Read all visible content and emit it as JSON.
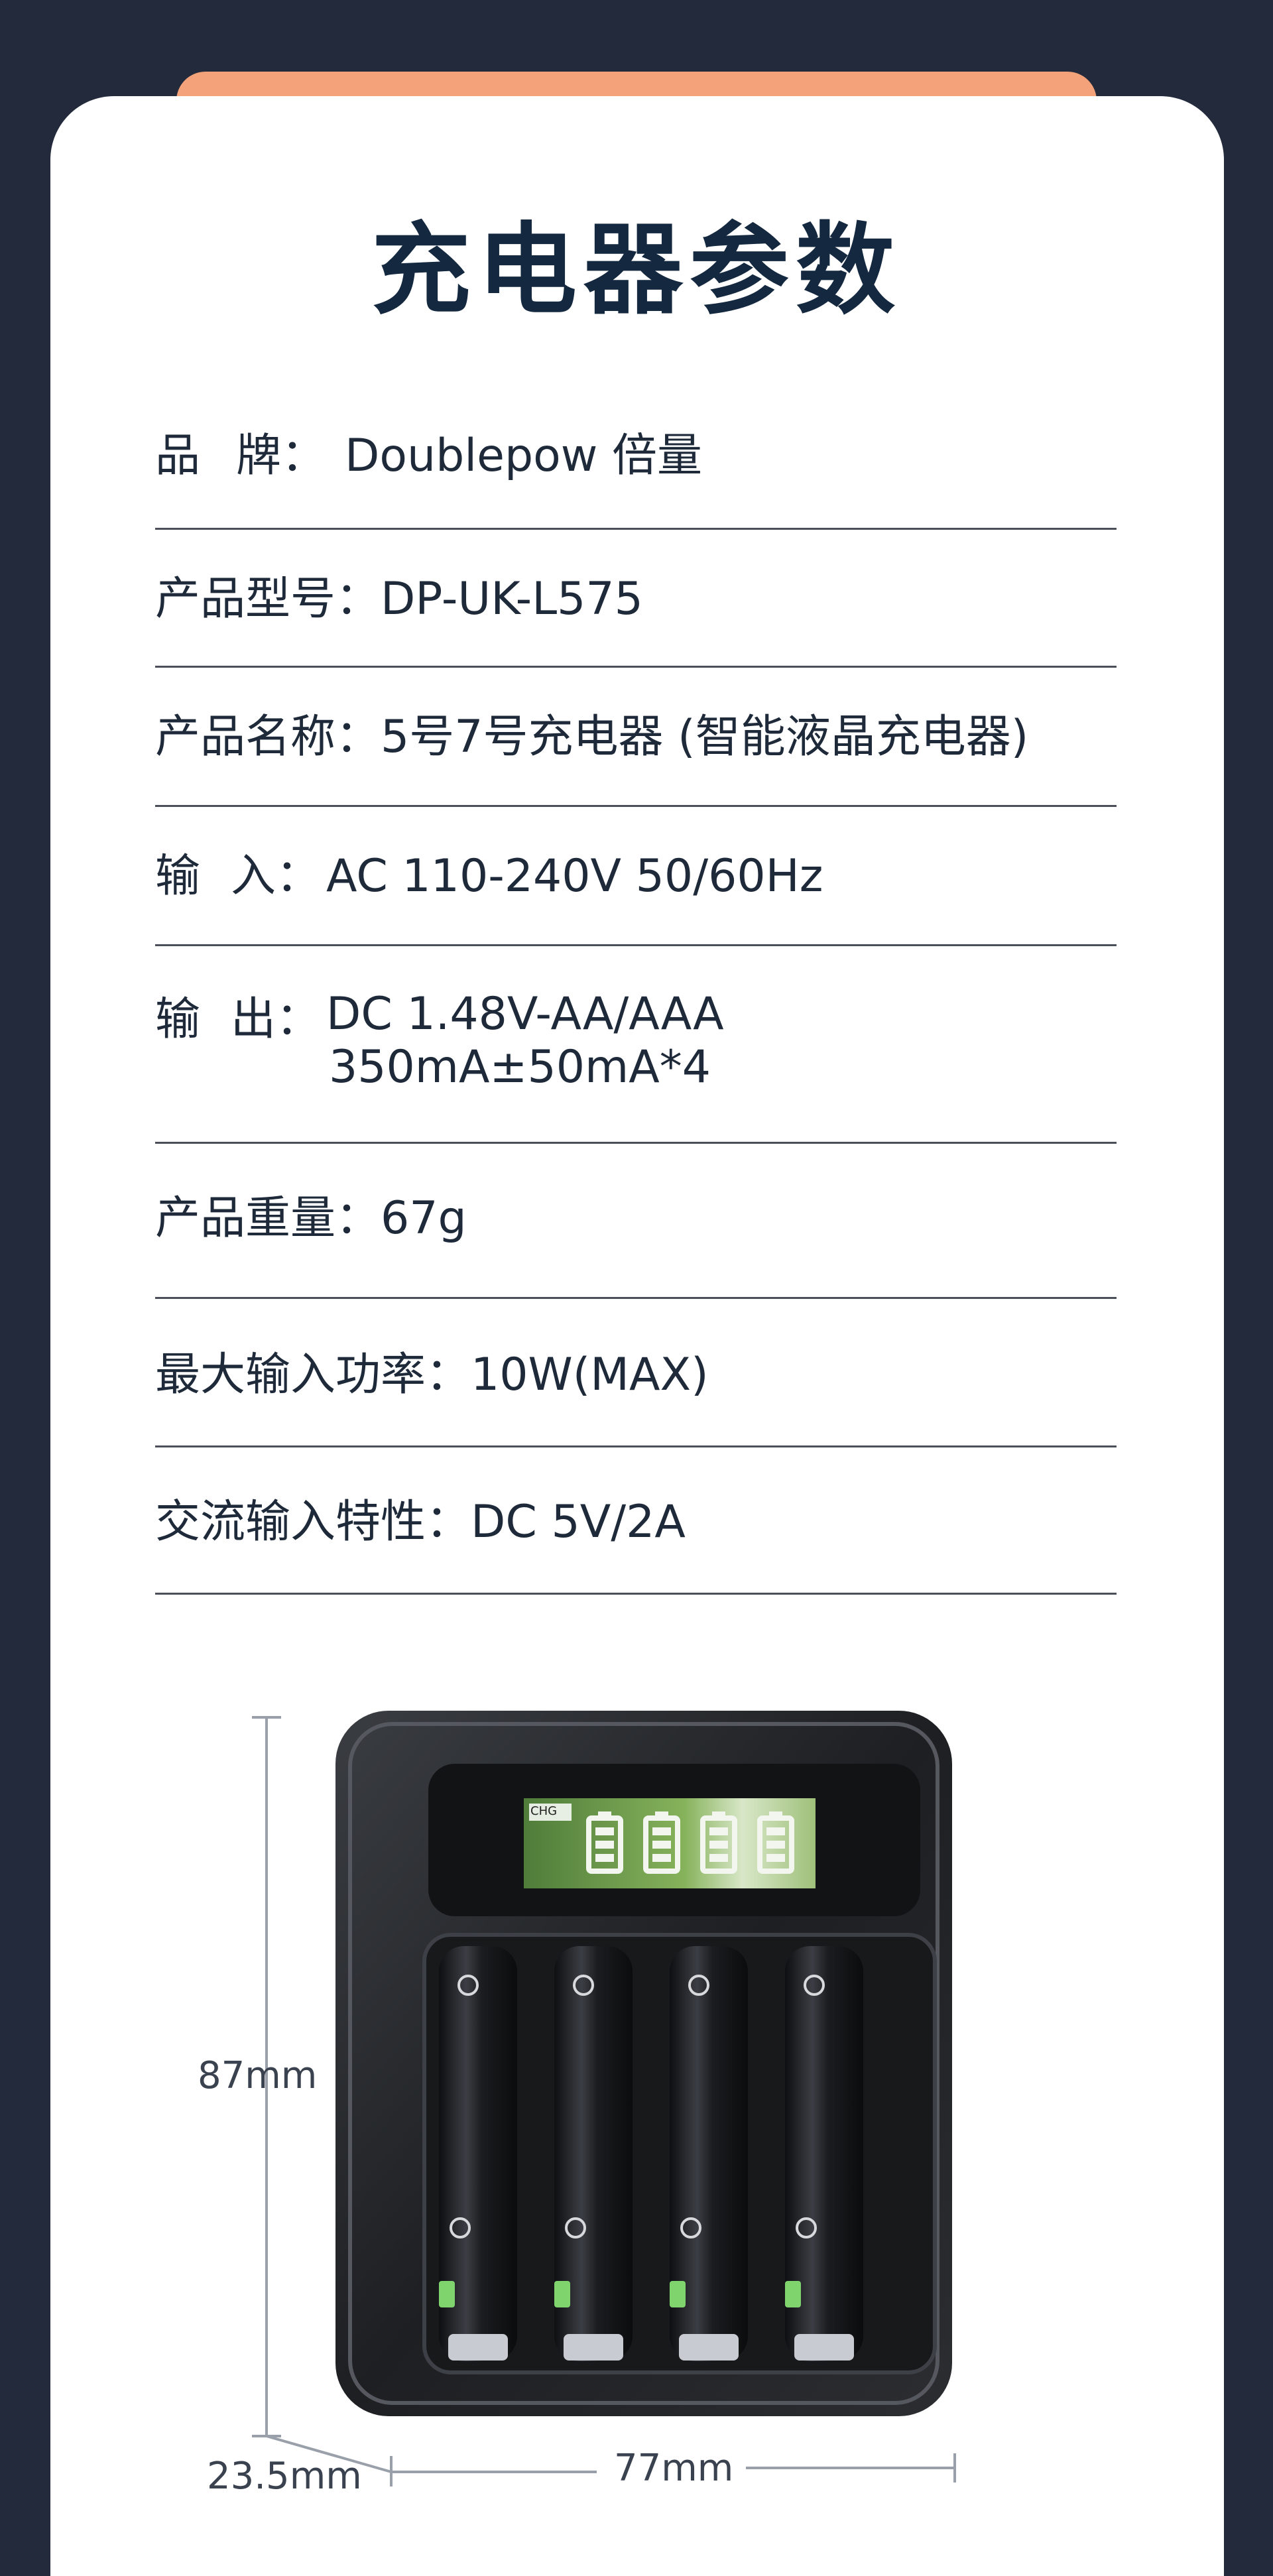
{
  "title": "充电器参数",
  "specs": {
    "brand": {
      "label_a": "品",
      "label_b": "牌：",
      "value": "Doublepow 倍量"
    },
    "model": {
      "label": "产品型号：",
      "value": "DP-UK-L575"
    },
    "name": {
      "label": "产品名称：",
      "value": "5号7号充电器 (智能液晶充电器)"
    },
    "input": {
      "label_a": "输",
      "label_b": "入：",
      "value": "AC 110-240V  50/60Hz"
    },
    "output": {
      "label_a": "输",
      "label_b": "出：",
      "value_line1": "DC 1.48V-AA/AAA",
      "value_line2": "350mA±50mA*4"
    },
    "weight": {
      "label": "产品重量：",
      "value": "67g"
    },
    "max_power": {
      "label": "最大输入功率：",
      "value": "10W(MAX)"
    },
    "ac_input": {
      "label": "交流输入特性：",
      "value": "DC 5V/2A"
    }
  },
  "dimensions": {
    "height": "87mm",
    "depth": "23.5mm",
    "width": "77mm"
  },
  "lcd": {
    "chg": "CHG"
  },
  "colors": {
    "background": "#232a3b",
    "card": "#ffffff",
    "accent_tab": "#f4a27a",
    "title": "#14283f"
  }
}
